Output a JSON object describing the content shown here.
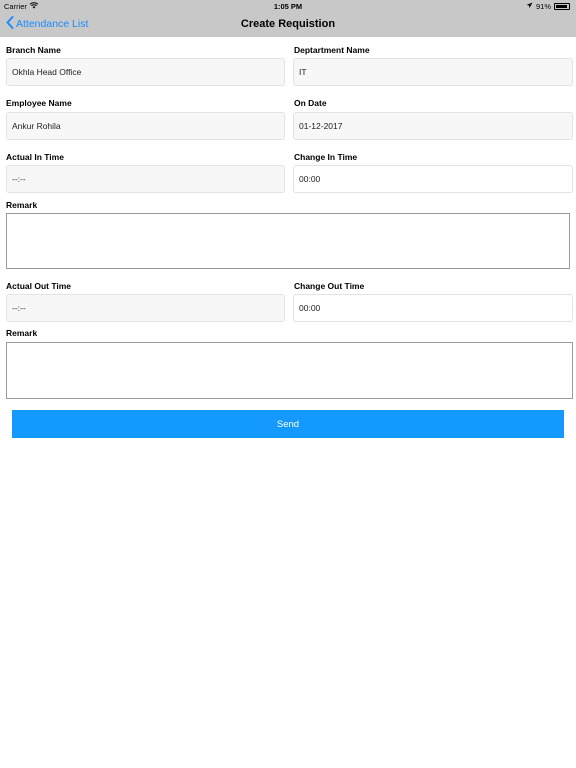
{
  "status": {
    "carrier": "Carrier",
    "time": "1:05 PM",
    "battery": "91%",
    "battery_level": 0.91
  },
  "nav": {
    "back_label": "Attendance List",
    "title": "Create Requistion"
  },
  "form": {
    "branch_label": "Branch Name",
    "branch_value": "Okhla Head Office",
    "department_label": "Deptartment Name",
    "department_value": "IT",
    "employee_label": "Employee Name",
    "employee_value": "Ankur Rohila",
    "ondate_label": "On Date",
    "ondate_value": "01-12-2017",
    "actual_in_label": "Actual In Time",
    "actual_in_value": "--:--",
    "change_in_label": "Change In Time",
    "change_in_value": "00:00",
    "remark1_label": "Remark",
    "remark1_value": "",
    "actual_out_label": "Actual Out Time",
    "actual_out_value": "--:--",
    "change_out_label": "Change Out Time",
    "change_out_value": "00:00",
    "remark2_label": "Remark",
    "remark2_value": "",
    "send_label": "Send"
  },
  "colors": {
    "accent": "#149aff",
    "link": "#1a8cff",
    "bar": "#c8c8c8"
  },
  "icons": {
    "wifi": "wifi-icon",
    "back": "chevron-left-icon",
    "location": "location-arrow-icon",
    "battery": "battery-icon"
  }
}
